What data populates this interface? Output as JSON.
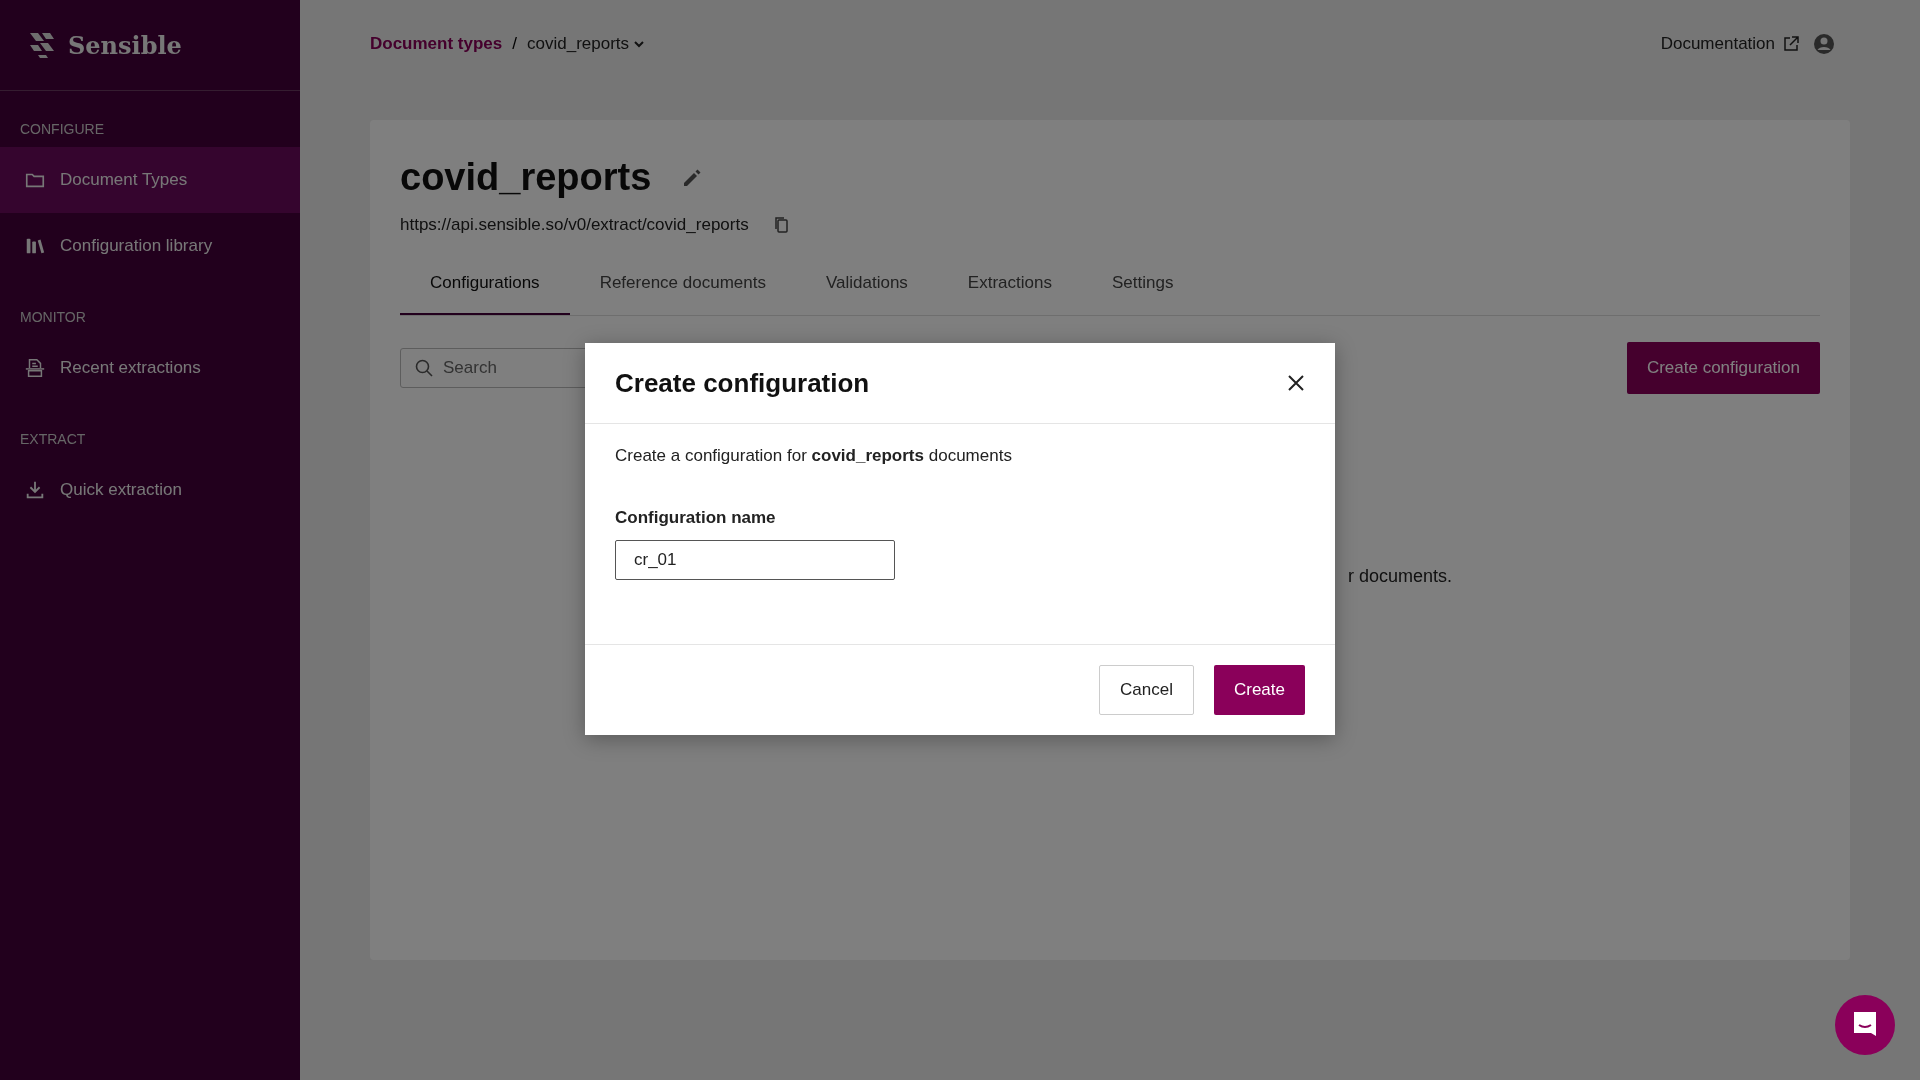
{
  "sidebar": {
    "logo": "Sensible",
    "sections": [
      {
        "heading": "CONFIGURE",
        "items": [
          {
            "label": "Document Types",
            "kind": "folder",
            "selected": true
          },
          {
            "label": "Configuration library",
            "kind": "library",
            "selected": false
          }
        ]
      },
      {
        "heading": "MONITOR",
        "items": [
          {
            "label": "Recent extractions",
            "kind": "printer",
            "selected": false
          }
        ]
      },
      {
        "heading": "EXTRACT",
        "items": [
          {
            "label": "Quick extraction",
            "kind": "download",
            "selected": false
          }
        ]
      }
    ]
  },
  "breadcrumb": {
    "parent": "Document types",
    "separator": "/",
    "current": "covid_reports"
  },
  "header": {
    "documentation": "Documentation"
  },
  "doc_type": {
    "title": "covid_reports",
    "url": "https://api.sensible.so/v0/extract/covid_reports"
  },
  "tabs": [
    {
      "label": "Configurations",
      "selected": true
    },
    {
      "label": "Reference documents",
      "selected": false
    },
    {
      "label": "Validations",
      "selected": false
    },
    {
      "label": "Extractions",
      "selected": false
    },
    {
      "label": "Settings",
      "selected": false
    }
  ],
  "search": {
    "placeholder": "Search"
  },
  "create_button": "Create configuration",
  "empty_message": "r documents.",
  "dialog": {
    "title": "Create configuration",
    "description": "Create a configuration for **covid_reports** documents",
    "field_label": "Configuration name",
    "field_value": "cr_01",
    "cancel": "Cancel",
    "confirm": "Create"
  }
}
